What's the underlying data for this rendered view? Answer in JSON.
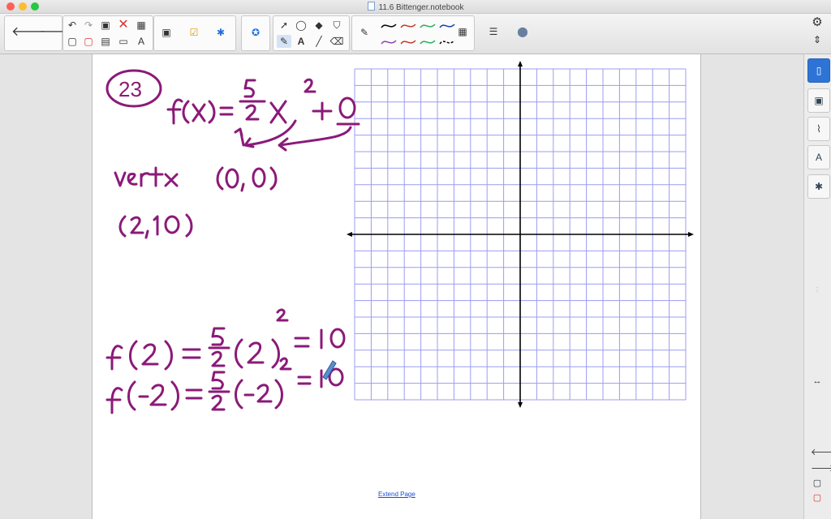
{
  "window": {
    "title": "11.6  Bittenger.notebook"
  },
  "toolbar": {
    "back": "back",
    "forward": "forward",
    "undo": "undo",
    "redo": "redo",
    "delete": "delete",
    "table": "table",
    "icons": [
      "arrow-left-icon",
      "arrow-right-icon",
      "undo-icon",
      "redo-icon",
      "delete-x-icon",
      "table-icon",
      "screen-shade-icon",
      "response-icon",
      "addons-icon",
      "capture-icon",
      "select-icon",
      "shapes-icon",
      "fill-icon",
      "pen-icon",
      "text-icon",
      "line-icon",
      "eraser-icon",
      "magic-pen-icon",
      "color-palette-icon",
      "line-style-icon",
      "properties-icon"
    ],
    "pen_colors": [
      "#000000",
      "#c0392b",
      "#27ae60",
      "#1f3fa8",
      "#8e44ad",
      "#c0392b",
      "#27ae60",
      "#000000"
    ]
  },
  "page": {
    "extend_label": "Extend Page",
    "problem_number": "23"
  },
  "sidebar": {
    "tabs": [
      "page-sorter-icon",
      "gallery-icon",
      "attachments-icon",
      "properties-icon",
      "addons-icon"
    ],
    "nav": [
      "previous-page-icon",
      "next-page-icon",
      "add-page-icon",
      "delete-page-icon"
    ]
  },
  "colors": {
    "ink": "#8b1a78",
    "grid": "#9c9cf0",
    "axis": "#000000",
    "accent": "#1f6fdd"
  }
}
